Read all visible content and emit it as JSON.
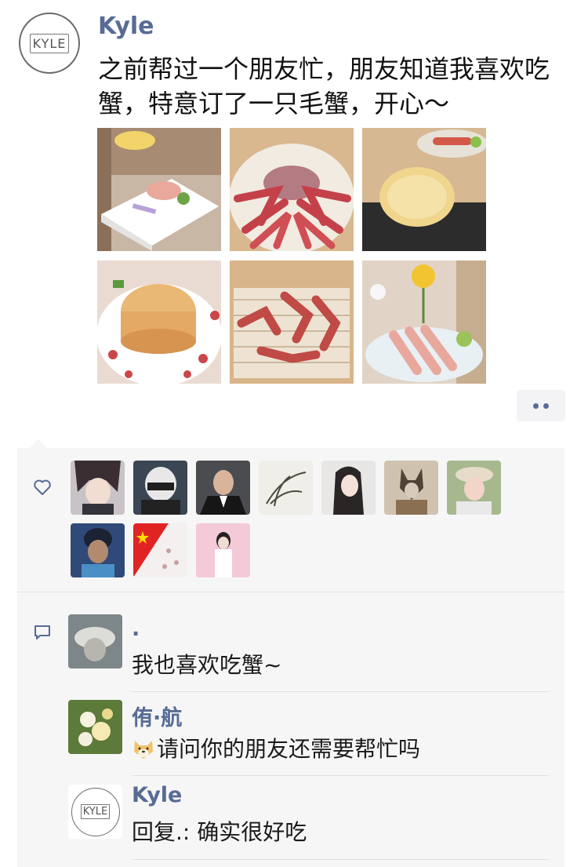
{
  "post": {
    "avatar_text": "KYLE",
    "author": "Kyle",
    "text": "之前帮过一个朋友忙，朋友知道我喜欢吃蟹，特意订了一只毛蟹，开心～",
    "photos": [
      "crab-sashimi-ice-plate",
      "whole-hairy-crab-steamer",
      "crab-shell-grilled-roe",
      "crab-roe-shell-plate",
      "crab-legs-on-rack",
      "crab-legs-platter-flower"
    ]
  },
  "actions": {
    "more_icon": "ellipsis-icon"
  },
  "likes": {
    "icon": "heart-icon",
    "avatars": [
      "anime-boy",
      "motorcycle-helmet",
      "man-in-suit",
      "orchid-painting",
      "girl-portrait",
      "dog-photo",
      "woman-in-hat",
      "cartoon-girl",
      "china-flag",
      "woman-pink-background"
    ]
  },
  "comments": {
    "icon": "comment-icon",
    "items": [
      {
        "name": ".",
        "text": "我也喜欢吃蟹~"
      },
      {
        "name": "侑·航",
        "text": "请问你的朋友还需要帮忙吗",
        "emoji": "doge-emoji"
      },
      {
        "name": "Kyle",
        "avatar_text": "KYLE",
        "text": "回复.: 确实很好吃"
      }
    ]
  }
}
